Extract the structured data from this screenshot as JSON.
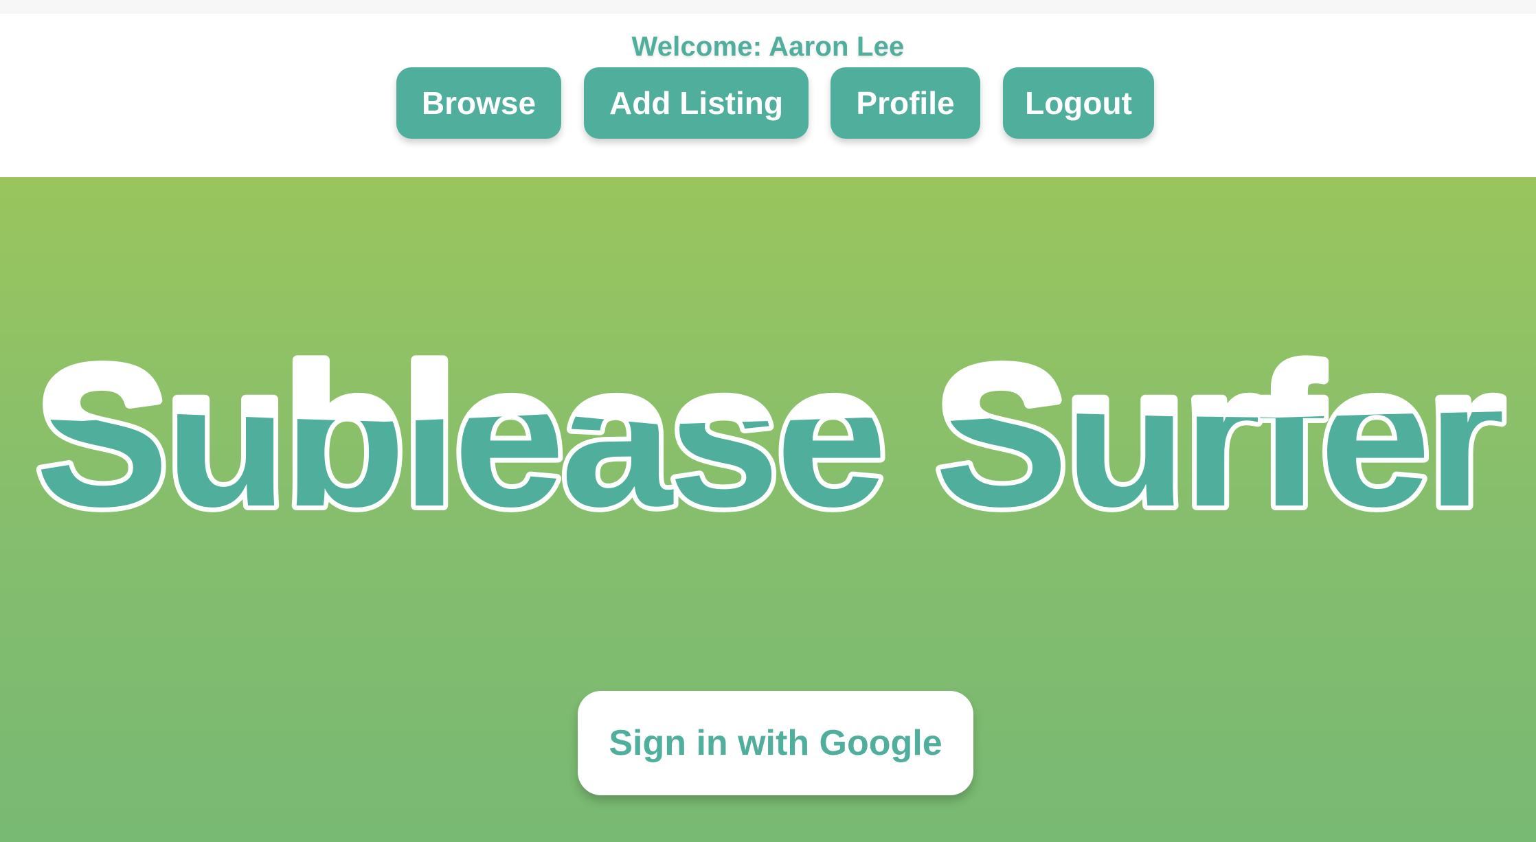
{
  "header": {
    "welcome_text": "Welcome: Aaron Lee",
    "nav": {
      "browse": "Browse",
      "add_listing": "Add Listing",
      "profile": "Profile",
      "logout": "Logout"
    }
  },
  "hero": {
    "brand_title": "Sublease Surfer",
    "sign_in_label": "Sign in with Google"
  },
  "colors": {
    "accent": "#4fae9c",
    "hero_top": "#9ac55d",
    "hero_bottom": "#78b973",
    "white": "#ffffff"
  }
}
